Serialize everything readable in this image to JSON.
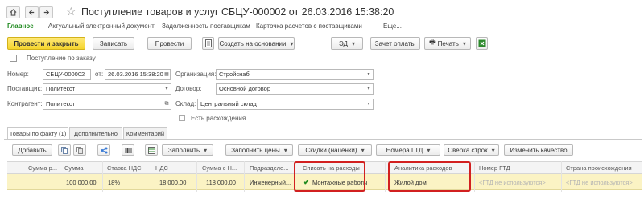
{
  "window": {
    "title": "Поступление товаров и услуг СБЦУ-000002 от 26.03.2016 15:38:20"
  },
  "nav": {
    "home_icon": "home-icon",
    "back_icon": "back-arrow-icon",
    "forward_icon": "forward-arrow-icon",
    "star_icon": "star-icon"
  },
  "tabs": [
    {
      "label": "Главное",
      "active": true
    },
    {
      "label": "Актуальный электронный документ"
    },
    {
      "label": "Задолженность поставщикам"
    },
    {
      "label": "Карточка расчетов с поставщиками"
    },
    {
      "label": "Еще..."
    }
  ],
  "toolbar": {
    "post_close": "Провести и закрыть",
    "save": "Записать",
    "post": "Провести",
    "create_based": "Создать на основании",
    "ed": "ЭД",
    "payment_offset": "Зачет оплаты",
    "print": "Печать"
  },
  "order_label": "Поступление по заказу",
  "form": {
    "number_label": "Номер:",
    "number_value": "СБЦУ-000002",
    "from_label": "от:",
    "date_value": "26.03.2016 15:38:20",
    "org_label": "Организация:",
    "org_value": "Стройснаб",
    "supplier_label": "Поставщик:",
    "supplier_value": "Политекст",
    "contract_label": "Договор:",
    "contract_value": "Основной договор",
    "counterparty_label": "Контрагент:",
    "counterparty_value": "Политекст",
    "warehouse_label": "Склад:",
    "warehouse_value": "Центральный склад",
    "discrepancy_label": "Есть расхождения"
  },
  "panel_tabs": [
    {
      "label": "Товары по факту (1)",
      "active": true
    },
    {
      "label": "Дополнительно"
    },
    {
      "label": "Комментарий"
    }
  ],
  "table_toolbar": {
    "add": "Добавить",
    "fill": "Заполнить",
    "fill_prices": "Заполнить цены",
    "discounts": "Скидки (наценки)",
    "gtd_numbers": "Номера ГТД",
    "reconcile": "Сверка строк",
    "change_quality": "Изменить качество"
  },
  "table": {
    "columns": [
      "Сумма р...",
      "Сумма",
      "Ставка НДС",
      "НДС",
      "Сумма с Н...",
      "Подразделе...",
      "Списать на расходы",
      "Аналитика расходов",
      "Номер ГТД",
      "Страна происхождения"
    ],
    "row": {
      "sum_r": "",
      "sum": "100 000,00",
      "vat_rate": "18%",
      "vat": "18 000,00",
      "sum_with_vat": "118 000,00",
      "department": "Инженерный...",
      "write_off": "Монтажные работы",
      "analytics": "Жилой дом",
      "gtd": "<ГТД не используются>",
      "country": "<ГТД не используются>"
    }
  },
  "colors": {
    "accent_green": "#1f8a1f",
    "primary_yellow": "#f5d52d",
    "highlight_red": "#d22020",
    "row_highlight": "#fbf3c4"
  }
}
